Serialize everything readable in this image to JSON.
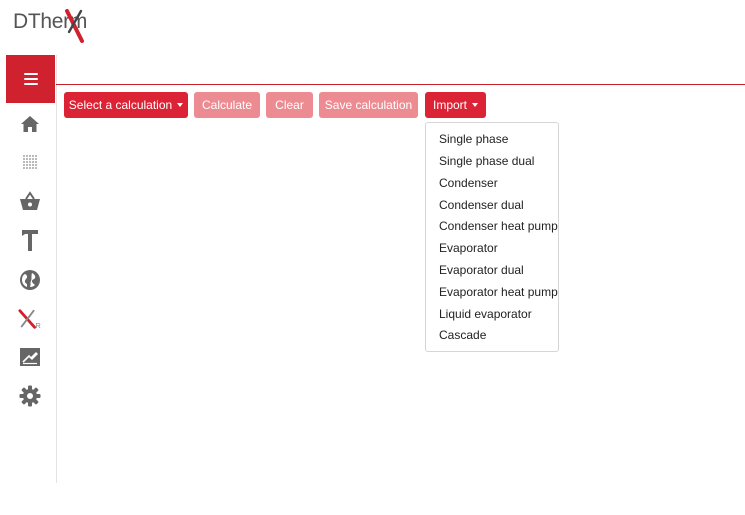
{
  "app": {
    "logo_text": "DTherm",
    "logo_mark": "X"
  },
  "sidebar": {
    "menu_icon": "hamburger-icon",
    "items": [
      {
        "icon": "home-icon"
      },
      {
        "icon": "dot-grid-icon"
      },
      {
        "icon": "basket-icon"
      },
      {
        "icon": "hammer-icon"
      },
      {
        "icon": "globe-icon"
      },
      {
        "icon": "xr-icon"
      },
      {
        "icon": "signature-icon"
      },
      {
        "icon": "gear-icon"
      }
    ]
  },
  "toolbar": {
    "select_calc_label": "Select a calculation",
    "calculate_label": "Calculate",
    "clear_label": "Clear",
    "save_label": "Save calculation",
    "import_label": "Import"
  },
  "import_menu": {
    "items": [
      "Single phase",
      "Single phase dual",
      "Condenser",
      "Condenser dual",
      "Condenser heat pump",
      "Evaporator",
      "Evaporator dual",
      "Evaporator heat pump",
      "Liquid evaporator",
      "Cascade"
    ]
  },
  "colors": {
    "primary": "#dc2336",
    "primary_faded": "#ec8c92",
    "logo_grey": "#555555"
  }
}
